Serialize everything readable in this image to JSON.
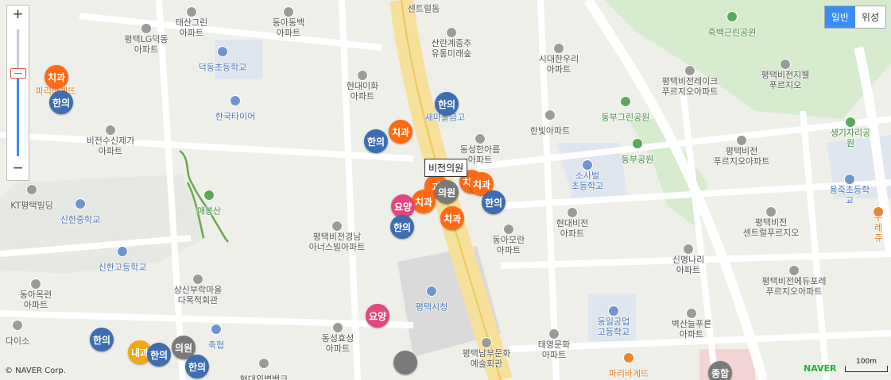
{
  "controls": {
    "zoom_in": "+",
    "zoom_out": "−",
    "map_types": [
      "일반",
      "위성"
    ],
    "active_map_type": "일반",
    "zoom_level": 0.38
  },
  "attribution": {
    "copyright": "© NAVER Corp.",
    "brand": "NAVER",
    "scale": "100m"
  },
  "tooltip": {
    "text": "비전의원"
  },
  "labels": [
    {
      "text": "태산그린\n아파트",
      "kind": "building"
    },
    {
      "text": "동아동백\n아파트",
      "kind": "building"
    },
    {
      "text": "센트럴돔",
      "kind": "building"
    },
    {
      "text": "평택LG덕동\n아파트",
      "kind": "building"
    },
    {
      "text": "덕동초등학교",
      "kind": "school"
    },
    {
      "text": "산란계중추\n유통미래숲",
      "kind": "building"
    },
    {
      "text": "시대한우리\n아파트",
      "kind": "building"
    },
    {
      "text": "죽백근린공원",
      "kind": "park"
    },
    {
      "text": "파리바게뜨",
      "kind": "food"
    },
    {
      "text": "현대이화\n아파트",
      "kind": "building"
    },
    {
      "text": "평택비전레이크\n푸르지오아파트",
      "kind": "building"
    },
    {
      "text": "평택비전지웰\n푸르지오",
      "kind": "building"
    },
    {
      "text": "한국타이어",
      "kind": "school"
    },
    {
      "text": "새마을금고",
      "kind": "school"
    },
    {
      "text": "한빛아파트",
      "kind": "building"
    },
    {
      "text": "동부그린공원",
      "kind": "park"
    },
    {
      "text": "생기자리공원",
      "kind": "park"
    },
    {
      "text": "비전수신제가\n아파트",
      "kind": "building"
    },
    {
      "text": "동성한아름\n아파트",
      "kind": "building"
    },
    {
      "text": "동부공원",
      "kind": "park"
    },
    {
      "text": "평택비전\n푸르지오아파트",
      "kind": "building"
    },
    {
      "text": "소사벌\n초등학교",
      "kind": "school"
    },
    {
      "text": "용죽초등학교",
      "kind": "school"
    },
    {
      "text": "KT평택빌딩",
      "kind": "building"
    },
    {
      "text": "매봉산",
      "kind": "park"
    },
    {
      "text": "신한중학교",
      "kind": "school"
    },
    {
      "text": "현대비전\n아파트",
      "kind": "building"
    },
    {
      "text": "평택비전\n센트럴푸르지오",
      "kind": "building"
    },
    {
      "text": "뚜레쥬",
      "kind": "food"
    },
    {
      "text": "동아모란\n아파트",
      "kind": "building"
    },
    {
      "text": "평택비전경남\n아너스빌아파트",
      "kind": "building"
    },
    {
      "text": "신한고등학교",
      "kind": "school"
    },
    {
      "text": "신명나리\n아파트",
      "kind": "building"
    },
    {
      "text": "동아목련\n아파트",
      "kind": "building"
    },
    {
      "text": "상신부락마을\n다목적회관",
      "kind": "building"
    },
    {
      "text": "평택비전에듀포레\n푸르지오아파트",
      "kind": "building"
    },
    {
      "text": "평택시청",
      "kind": "school"
    },
    {
      "text": "동일공업\n고등학교",
      "kind": "school"
    },
    {
      "text": "벽산늘푸른\n아파트",
      "kind": "building"
    },
    {
      "text": "다이소",
      "kind": "building"
    },
    {
      "text": "축협",
      "kind": "school"
    },
    {
      "text": "동성효성\n아파트",
      "kind": "building"
    },
    {
      "text": "평택남부문화\n예술회관",
      "kind": "building"
    },
    {
      "text": "태영문화\n아파트",
      "kind": "building"
    },
    {
      "text": "파리바게뜨",
      "kind": "food"
    },
    {
      "text": "현대외벽뱅크",
      "kind": "building"
    }
  ],
  "markers": [
    {
      "label": "치과",
      "color": "#ff6a13"
    },
    {
      "label": "한의",
      "color": "#3f6db1"
    },
    {
      "label": "한의",
      "color": "#3f6db1"
    },
    {
      "label": "치과",
      "color": "#ff6a13"
    },
    {
      "label": "한의",
      "color": "#3f6db1"
    },
    {
      "label": "치과",
      "color": "#ff6a13"
    },
    {
      "label": "치과",
      "color": "#ff6a13"
    },
    {
      "label": "과",
      "color": "#ff6a13"
    },
    {
      "label": "의원",
      "color": "#7a7a7a"
    },
    {
      "label": "치과",
      "color": "#ff6a13"
    },
    {
      "label": "요양",
      "color": "#e0487d"
    },
    {
      "label": "한의",
      "color": "#3f6db1"
    },
    {
      "label": "치과",
      "color": "#ff6a13"
    },
    {
      "label": "한의",
      "color": "#3f6db1"
    },
    {
      "label": "요양",
      "color": "#e0487d"
    },
    {
      "label": "한의",
      "color": "#3f6db1"
    },
    {
      "label": "내과",
      "color": "#f5a70f"
    },
    {
      "label": "한의",
      "color": "#3f6db1"
    },
    {
      "label": "의원",
      "color": "#7a7a7a"
    },
    {
      "label": "한의",
      "color": "#3f6db1"
    },
    {
      "label": "",
      "color": "#7a7a7a"
    },
    {
      "label": "종합",
      "color": "#7a7a7a"
    }
  ]
}
